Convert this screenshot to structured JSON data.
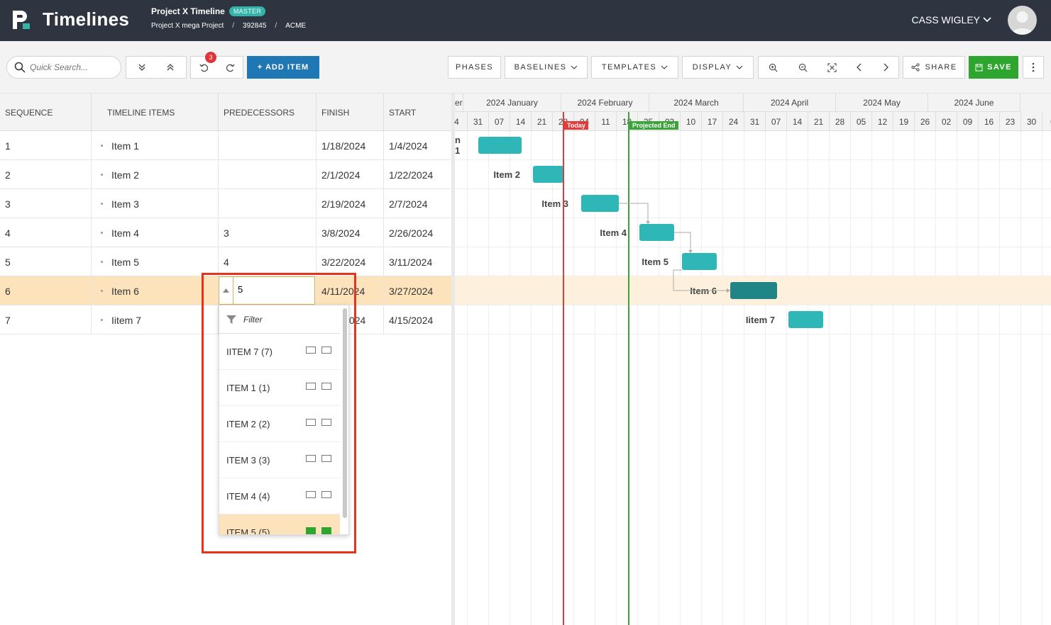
{
  "header": {
    "app_name": "Timelines",
    "project_title": "Project X Timeline",
    "badge": "MASTER",
    "breadcrumb": [
      "Project X mega Project",
      "392845",
      "ACME"
    ],
    "user_name": "CASS WIGLEY"
  },
  "toolbar": {
    "search_placeholder": "Quick Search...",
    "undo_count": "3",
    "add_item": "+ ADD ITEM",
    "phases": "PHASES",
    "baselines": "BASELINES",
    "templates": "TEMPLATES",
    "display": "DISPLAY",
    "share": "SHARE",
    "save": "SAVE"
  },
  "grid": {
    "columns": [
      "SEQUENCE",
      "TIMELINE ITEMS",
      "PREDECESSORS",
      "FINISH",
      "START"
    ],
    "rows": [
      {
        "seq": "1",
        "item": "Item 1",
        "pred": "",
        "finish": "1/18/2024",
        "start": "1/4/2024"
      },
      {
        "seq": "2",
        "item": "Item 2",
        "pred": "",
        "finish": "2/1/2024",
        "start": "1/22/2024"
      },
      {
        "seq": "3",
        "item": "Item 3",
        "pred": "",
        "finish": "2/19/2024",
        "start": "2/7/2024"
      },
      {
        "seq": "4",
        "item": "Item 4",
        "pred": "3",
        "finish": "3/8/2024",
        "start": "2/26/2024"
      },
      {
        "seq": "5",
        "item": "Item 5",
        "pred": "4",
        "finish": "3/22/2024",
        "start": "3/11/2024"
      },
      {
        "seq": "6",
        "item": "Item 6",
        "pred": "",
        "finish": "4/11/2024",
        "start": "3/27/2024"
      },
      {
        "seq": "7",
        "item": "Iitem 7",
        "pred": "",
        "finish": "4/24/2024",
        "start": "4/15/2024"
      }
    ]
  },
  "editor": {
    "value": "5",
    "filter_placeholder": "Filter",
    "options": [
      {
        "label": "IITEM 7 (7)",
        "checked": false
      },
      {
        "label": "ITEM 1 (1)",
        "checked": false
      },
      {
        "label": "ITEM 2 (2)",
        "checked": false
      },
      {
        "label": "ITEM 3 (3)",
        "checked": false
      },
      {
        "label": "ITEM 4 (4)",
        "checked": false
      },
      {
        "label": "ITEM 5 (5)",
        "checked": true
      }
    ]
  },
  "gantt": {
    "months": [
      "er",
      "2024 January",
      "2024 February",
      "2024 March",
      "2024 April",
      "2024 May",
      "2024 June"
    ],
    "weeks": [
      "4",
      "31",
      "07",
      "14",
      "21",
      "28",
      "04",
      "11",
      "18",
      "25",
      "03",
      "10",
      "17",
      "24",
      "31",
      "07",
      "14",
      "21",
      "28",
      "05",
      "12",
      "19",
      "26",
      "02",
      "09",
      "16",
      "23",
      "30",
      "0"
    ],
    "today_label": "Today",
    "projected_end_label": "Projected End",
    "bar_labels": [
      "n 1",
      "Item 2",
      "Item 3",
      "Item 4",
      "Item 5",
      "Item 6",
      "Iitem 7"
    ]
  },
  "colors": {
    "header_bg": "#2f3540",
    "accent_blue": "#1f77b4",
    "save_green": "#2ea52e",
    "bar_teal": "#2fb6b6",
    "bar_selected": "#1f8587",
    "today_red": "#e43a3a",
    "selected_row": "#fde3bc"
  }
}
